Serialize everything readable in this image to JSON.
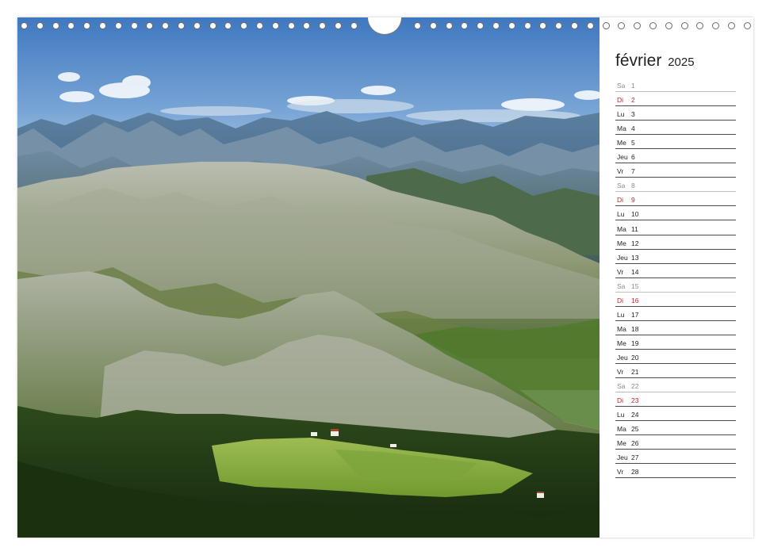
{
  "calendar": {
    "month": "février",
    "year": "2025"
  },
  "days": [
    {
      "wd": "Sa",
      "d": "1",
      "type": "sat"
    },
    {
      "wd": "Di",
      "d": "2",
      "type": "sun"
    },
    {
      "wd": "Lu",
      "d": "3",
      "type": "normal"
    },
    {
      "wd": "Ma",
      "d": "4",
      "type": "normal"
    },
    {
      "wd": "Me",
      "d": "5",
      "type": "normal"
    },
    {
      "wd": "Jeu",
      "d": "6",
      "type": "normal"
    },
    {
      "wd": "Vr",
      "d": "7",
      "type": "normal"
    },
    {
      "wd": "Sa",
      "d": "8",
      "type": "sat"
    },
    {
      "wd": "Di",
      "d": "9",
      "type": "sun"
    },
    {
      "wd": "Lu",
      "d": "10",
      "type": "normal"
    },
    {
      "wd": "Ma",
      "d": "11",
      "type": "normal"
    },
    {
      "wd": "Me",
      "d": "12",
      "type": "normal"
    },
    {
      "wd": "Jeu",
      "d": "13",
      "type": "normal"
    },
    {
      "wd": "Vr",
      "d": "14",
      "type": "normal"
    },
    {
      "wd": "Sa",
      "d": "15",
      "type": "sat"
    },
    {
      "wd": "Di",
      "d": "16",
      "type": "sun"
    },
    {
      "wd": "Lu",
      "d": "17",
      "type": "normal"
    },
    {
      "wd": "Ma",
      "d": "18",
      "type": "normal"
    },
    {
      "wd": "Me",
      "d": "19",
      "type": "normal"
    },
    {
      "wd": "Jeu",
      "d": "20",
      "type": "normal"
    },
    {
      "wd": "Vr",
      "d": "21",
      "type": "normal"
    },
    {
      "wd": "Sa",
      "d": "22",
      "type": "sat"
    },
    {
      "wd": "Di",
      "d": "23",
      "type": "sun"
    },
    {
      "wd": "Lu",
      "d": "24",
      "type": "normal"
    },
    {
      "wd": "Ma",
      "d": "25",
      "type": "normal"
    },
    {
      "wd": "Me",
      "d": "26",
      "type": "normal"
    },
    {
      "wd": "Jeu",
      "d": "27",
      "type": "normal"
    },
    {
      "wd": "Vr",
      "d": "28",
      "type": "normal"
    }
  ],
  "colors": {
    "sunday": "#c8202f",
    "saturday": "#8a8a8a",
    "weekday": "#222222"
  },
  "photo": {
    "subject": "mountain-landscape"
  }
}
